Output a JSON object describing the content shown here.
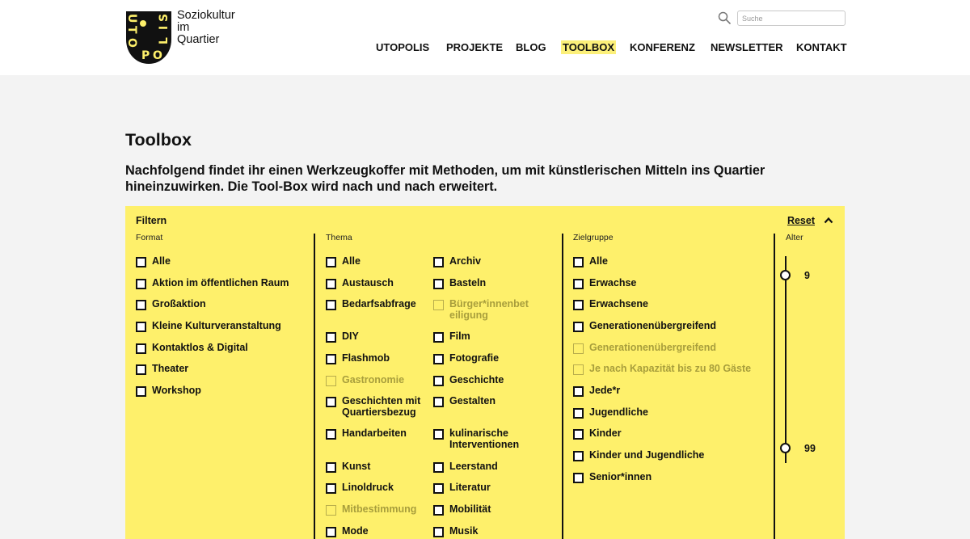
{
  "brand": {
    "line1": "Soziokultur",
    "line2": "im",
    "line3": "Quartier",
    "logo_text": "UTOPOLIS"
  },
  "search": {
    "placeholder": "Suche",
    "value": ""
  },
  "nav": [
    {
      "label": "UTOPOLIS",
      "active": false
    },
    {
      "label": "PROJEKTE",
      "active": false
    },
    {
      "label": "BLOG",
      "active": false
    },
    {
      "label": "TOOLBOX",
      "active": true
    },
    {
      "label": "KONFERENZ",
      "active": false
    },
    {
      "label": "NEWSLETTER",
      "active": false
    },
    {
      "label": "KONTAKT",
      "active": false
    }
  ],
  "page": {
    "title": "Toolbox",
    "intro": "Nachfolgend findet ihr einen Werkzeugkoffer mit Methoden, um mit künstlerischen Mitteln ins Quartier hineinzuwirken. Die Tool-Box wird nach und nach erweitert."
  },
  "filter": {
    "title": "Filtern",
    "reset_label": "Reset",
    "format": {
      "label": "Format",
      "options": [
        {
          "label": "Alle",
          "enabled": true
        },
        {
          "label": "Aktion im öffentlichen Raum",
          "enabled": true
        },
        {
          "label": "Großaktion",
          "enabled": true
        },
        {
          "label": "Kleine Kulturveranstaltung",
          "enabled": true
        },
        {
          "label": "Kontaktlos & Digital",
          "enabled": true
        },
        {
          "label": "Theater",
          "enabled": true
        },
        {
          "label": "Workshop",
          "enabled": true
        }
      ]
    },
    "thema": {
      "label": "Thema",
      "col1": [
        {
          "label": "Alle",
          "enabled": true
        },
        {
          "label": "Austausch",
          "enabled": true
        },
        {
          "label": "Bedarfsabfrage",
          "enabled": true
        },
        {
          "label": "DIY",
          "enabled": true
        },
        {
          "label": "Flashmob",
          "enabled": true
        },
        {
          "label": "Gastronomie",
          "enabled": false
        },
        {
          "label": "Geschichten mit\nQuartiersbezug",
          "enabled": true
        },
        {
          "label": "Handarbeiten",
          "enabled": true
        },
        {
          "label": "Kunst",
          "enabled": true
        },
        {
          "label": "Linoldruck",
          "enabled": true
        },
        {
          "label": "Mitbestimmung",
          "enabled": false
        },
        {
          "label": "Mode",
          "enabled": true
        }
      ],
      "col2": [
        {
          "label": "Archiv",
          "enabled": true
        },
        {
          "label": "Basteln",
          "enabled": true
        },
        {
          "label": "Bürger*innenbet\neiligung",
          "enabled": false
        },
        {
          "label": "Film",
          "enabled": true
        },
        {
          "label": "Fotografie",
          "enabled": true
        },
        {
          "label": "Geschichte",
          "enabled": true
        },
        {
          "label": "Gestalten",
          "enabled": true
        },
        {
          "label": "kulinarische\nInterventionen",
          "enabled": true
        },
        {
          "label": "Leerstand",
          "enabled": true
        },
        {
          "label": "Literatur",
          "enabled": true
        },
        {
          "label": "Mobilität",
          "enabled": true
        },
        {
          "label": "Musik",
          "enabled": true
        }
      ]
    },
    "zielgruppe": {
      "label": "Zielgruppe",
      "options": [
        {
          "label": "Alle",
          "enabled": true
        },
        {
          "label": "Erwachse",
          "enabled": true
        },
        {
          "label": "Erwachsene",
          "enabled": true
        },
        {
          "label": "Generationenübergreifend",
          "enabled": true
        },
        {
          "label": "Generationenübergreifend",
          "enabled": false
        },
        {
          "label": "Je nach Kapazität bis zu 80 Gäste",
          "enabled": false
        },
        {
          "label": "Jede*r",
          "enabled": true
        },
        {
          "label": "Jugendliche",
          "enabled": true
        },
        {
          "label": "Kinder",
          "enabled": true
        },
        {
          "label": "Kinder und Jugendliche",
          "enabled": true
        },
        {
          "label": "Senior*innen",
          "enabled": true
        }
      ]
    },
    "alter": {
      "label": "Alter",
      "min": "9",
      "max": "99"
    }
  }
}
